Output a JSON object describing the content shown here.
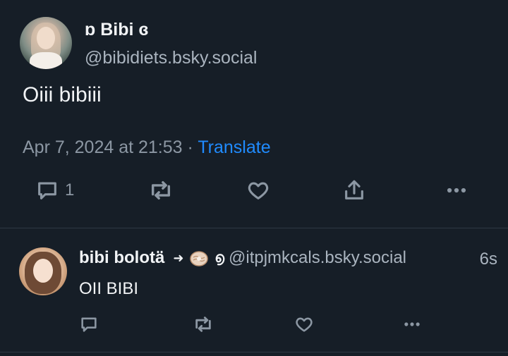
{
  "post": {
    "author": {
      "display_name": "ɒ Bibi ɞ",
      "handle": "@bibidiets.bsky.social"
    },
    "text": "Oiii bibiii",
    "timestamp": "Apr 7, 2024 at 21:53",
    "separator": " · ",
    "translate_label": "Translate",
    "actions": {
      "reply_icon": "comment-icon",
      "reply_count": "1",
      "repost_icon": "repost-icon",
      "like_icon": "heart-icon",
      "share_icon": "share-icon",
      "more_icon": "more-dots-icon"
    }
  },
  "reply": {
    "author": {
      "display_name": "bibi bolotä̈",
      "arrow": "➜",
      "emoji_icon": "oyster-icon",
      "glyph": "൭",
      "handle": "@itpjmkcals.bsky.social"
    },
    "time_ago": "6s",
    "text": "OII BIBI",
    "actions": {
      "reply_icon": "comment-icon",
      "repost_icon": "repost-icon",
      "like_icon": "heart-icon",
      "more_icon": "more-dots-icon"
    }
  },
  "colors": {
    "background": "#161e27",
    "text": "#f1f3f5",
    "muted": "#8c97a3",
    "accent": "#208bfe",
    "divider": "#2e3843"
  }
}
